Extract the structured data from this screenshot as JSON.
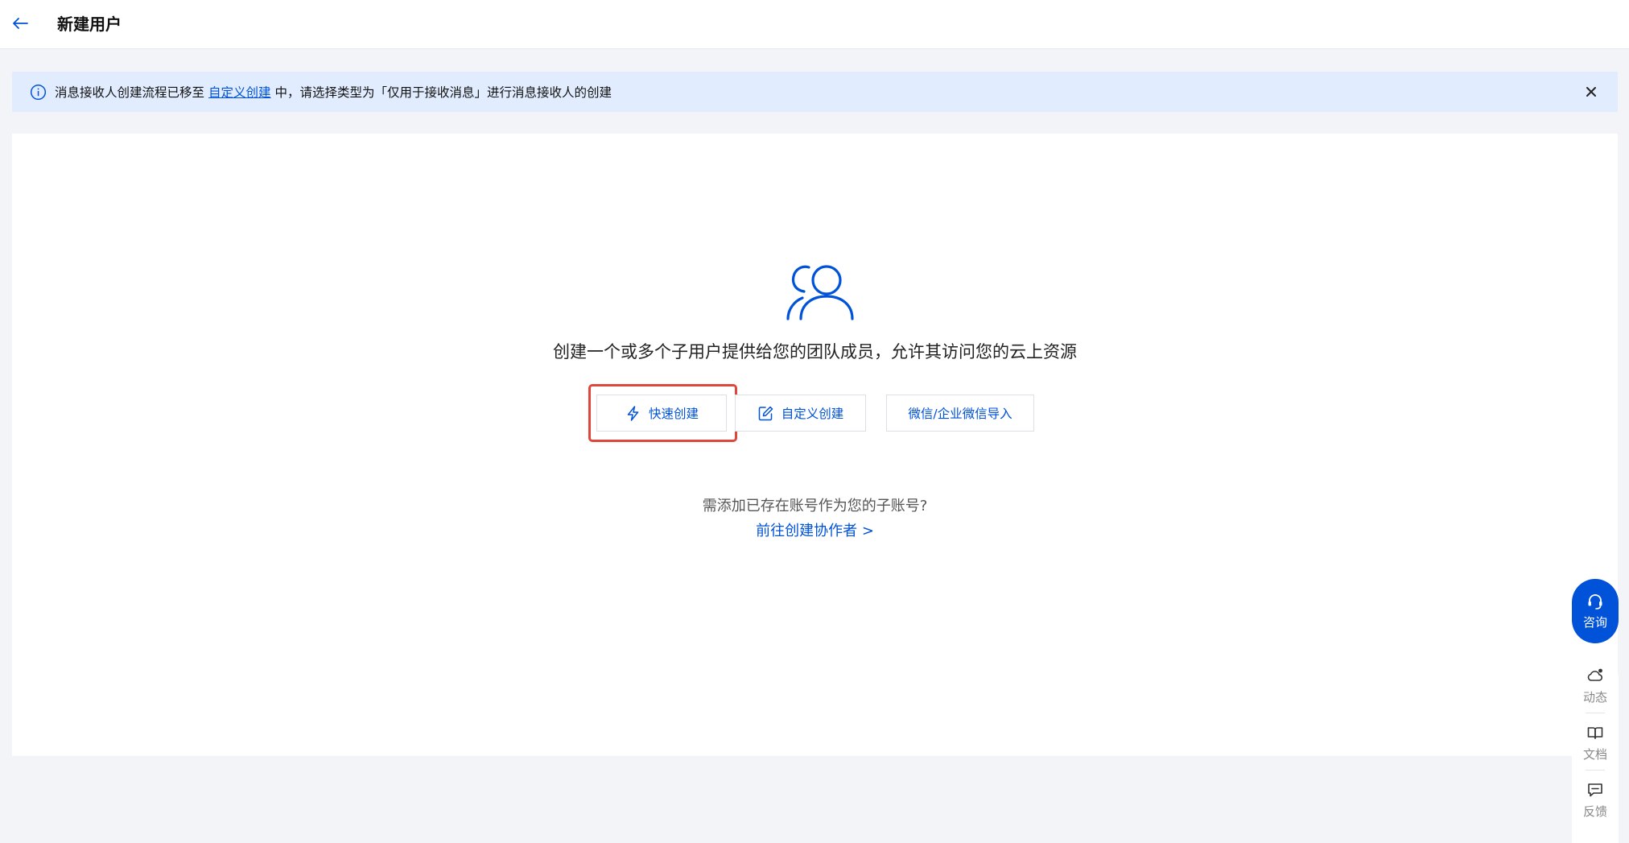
{
  "header": {
    "title": "新建用户"
  },
  "notice": {
    "text_before": "消息接收人创建流程已移至",
    "link": "自定义创建",
    "text_after": "中，请选择类型为「仅用于接收消息」进行消息接收人的创建"
  },
  "main": {
    "headline": "创建一个或多个子用户提供给您的团队成员，允许其访问您的云上资源",
    "buttons": {
      "quick": "快速创建",
      "custom": "自定义创建",
      "wechat": "微信/企业微信导入"
    },
    "question": "需添加已存在账号作为您的子账号?",
    "collab_link": "前往创建协作者 >"
  },
  "side": {
    "consult": "咨询",
    "dynamics": "动态",
    "docs": "文档",
    "feedback": "反馈"
  },
  "colors": {
    "primary": "#0052d9",
    "notice_bg": "#e1edff",
    "highlight": "#e0473c",
    "page_bg": "#f3f4f7"
  }
}
